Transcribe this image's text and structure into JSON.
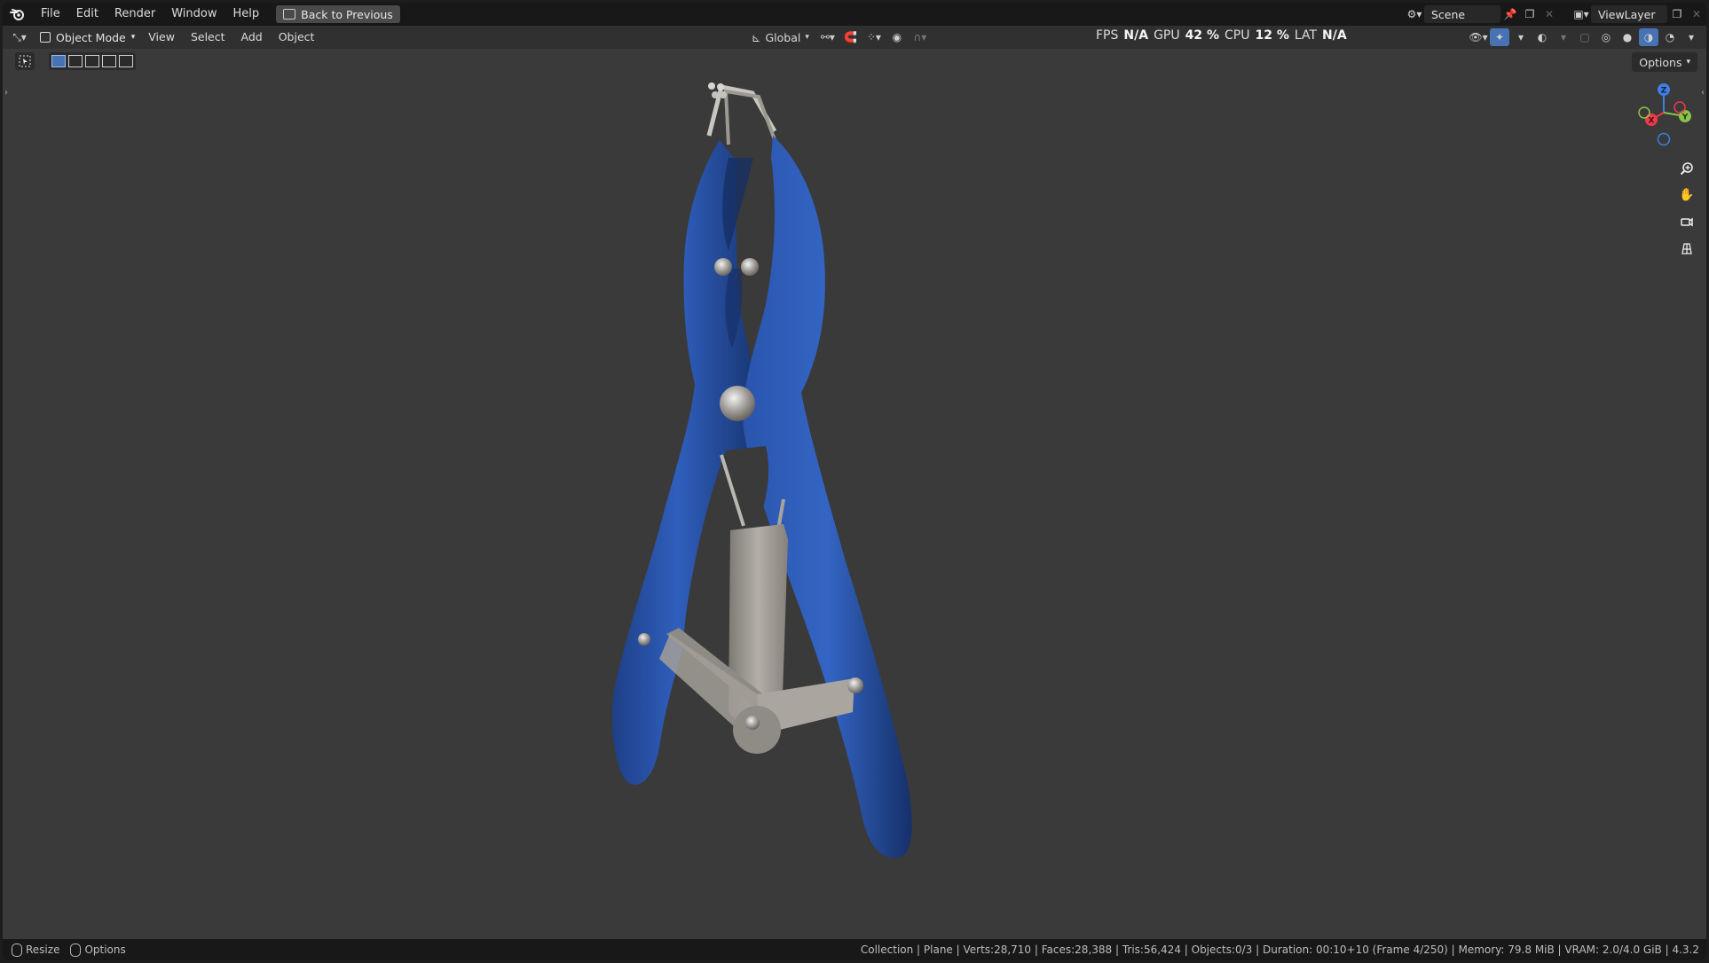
{
  "topbar": {
    "menus": [
      "File",
      "Edit",
      "Render",
      "Window",
      "Help"
    ],
    "back_button": "Back to Previous",
    "scene_name": "Scene",
    "view_layer": "ViewLayer"
  },
  "header": {
    "mode": "Object Mode",
    "menus": [
      "View",
      "Select",
      "Add",
      "Object"
    ],
    "transform_orientation": "Global",
    "options_label": "Options"
  },
  "perf": {
    "fps_label": "FPS",
    "fps_value": "N/A",
    "gpu_label": "GPU",
    "gpu_value": "42 %",
    "cpu_label": "CPU",
    "cpu_value": "12 %",
    "lat_label": "LAT",
    "lat_value": "N/A"
  },
  "gizmo": {
    "axes": [
      "X",
      "Y",
      "Z"
    ],
    "colors": {
      "x": "#ee3b4a",
      "y": "#8bc34a",
      "z": "#3f7fe0"
    }
  },
  "nav_icons": [
    "zoom-icon",
    "pan-hand-icon",
    "camera-view-icon",
    "ortho-grid-icon"
  ],
  "object": {
    "handle_color": "#2a55a8",
    "metal_color": "#9a9690"
  },
  "statusbar": {
    "resize_label": "Resize",
    "options_label": "Options",
    "stats": "Collection | Plane | Verts:28,710 | Faces:28,388 | Tris:56,424 | Objects:0/3 | Duration: 00:10+10 (Frame 4/250) | Memory: 79.8 MiB | VRAM: 2.0/4.0 GiB | 4.3.2"
  }
}
